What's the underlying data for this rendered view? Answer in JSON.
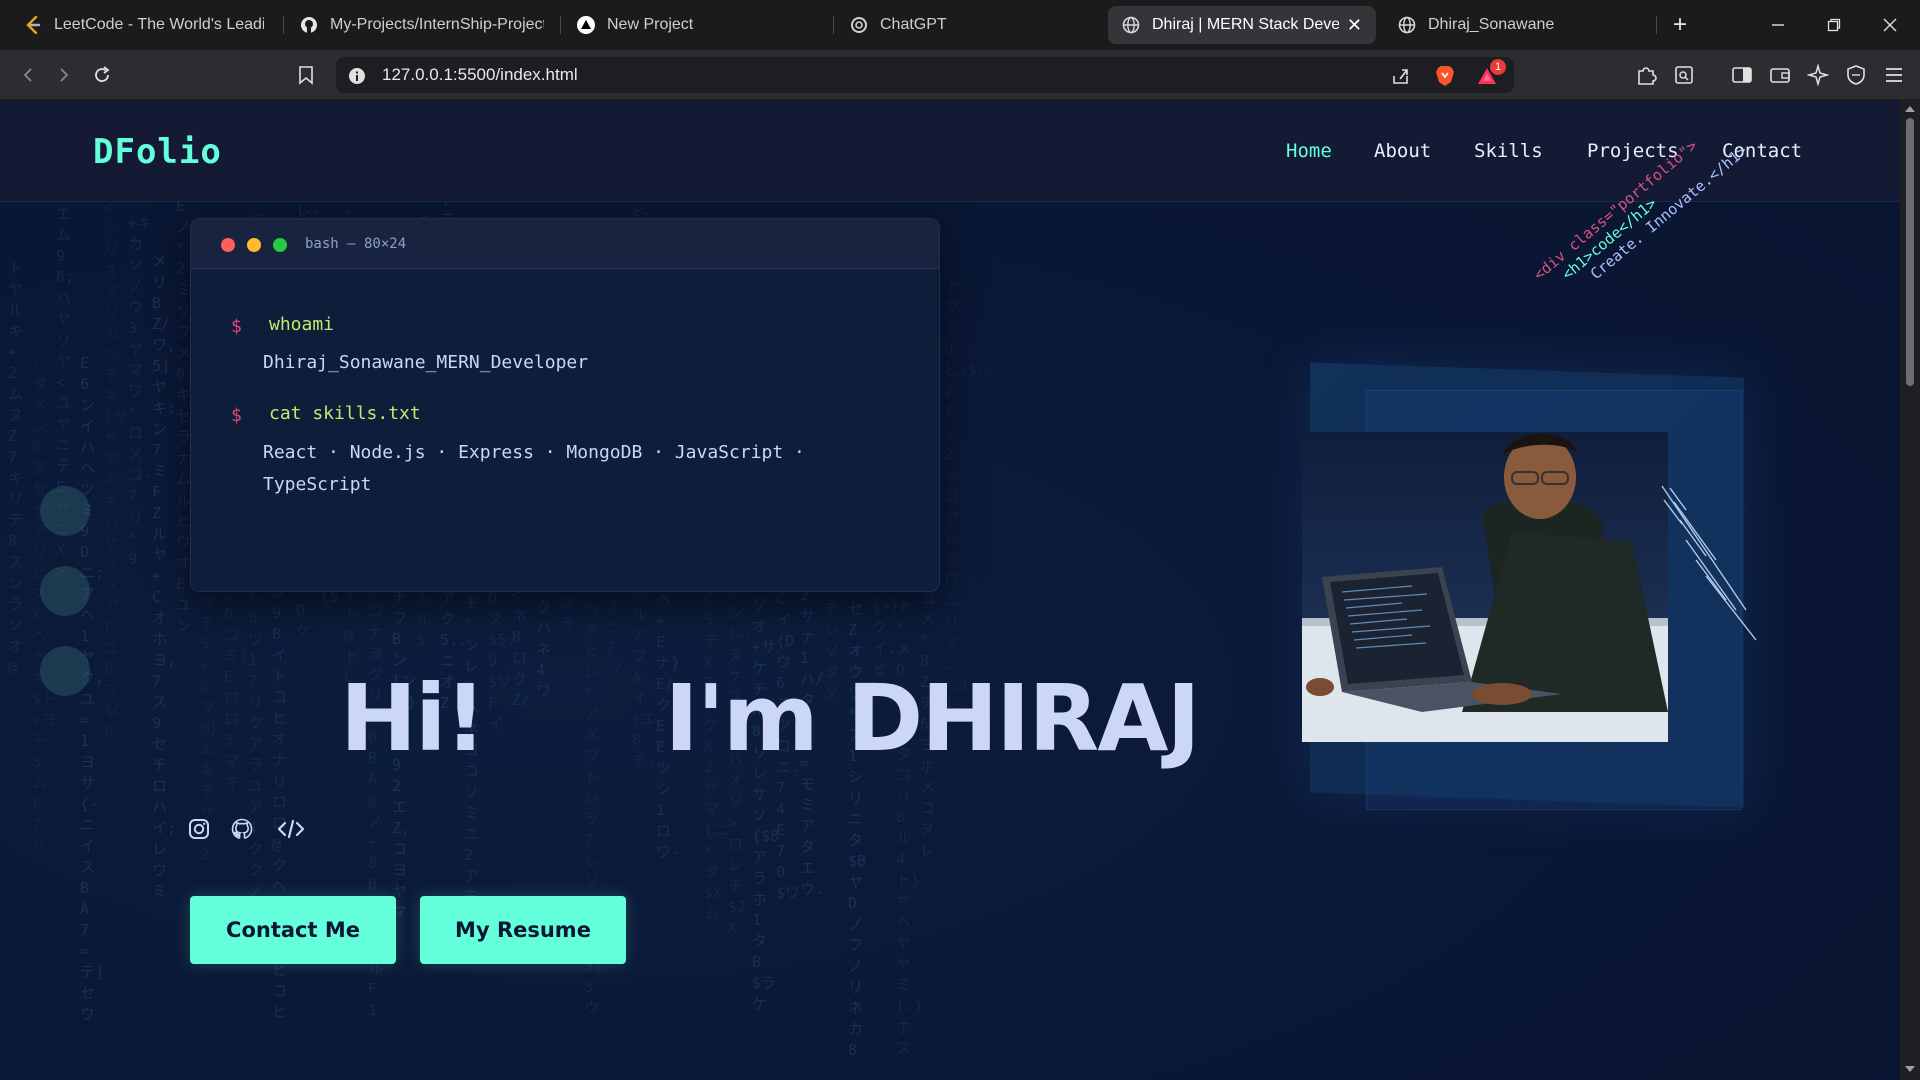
{
  "browser": {
    "tabs": [
      {
        "title": "LeetCode - The World's Leading",
        "icon": "leetcode-icon",
        "active": false
      },
      {
        "title": "My-Projects/InternShip-Project-l",
        "icon": "github-icon",
        "active": false
      },
      {
        "title": "New Project",
        "icon": "vercel-icon",
        "active": false
      },
      {
        "title": "ChatGPT",
        "icon": "chatgpt-icon",
        "active": false
      },
      {
        "title": "Dhiraj | MERN Stack Develop",
        "icon": "globe-icon",
        "active": true
      },
      {
        "title": "Dhiraj_Sonawane",
        "icon": "globe-icon",
        "active": false
      }
    ],
    "url": "127.0.0.1:5500/index.html",
    "notification_count": "1"
  },
  "site": {
    "logo": "DFolio",
    "nav": [
      {
        "label": "Home",
        "active": true
      },
      {
        "label": "About",
        "active": false
      },
      {
        "label": "Skills",
        "active": false
      },
      {
        "label": "Projects",
        "active": false
      },
      {
        "label": "Contact",
        "active": false
      }
    ],
    "terminal": {
      "title": "bash — 80×24",
      "prompt": "$",
      "cmd1": "whoami",
      "out1": "Dhiraj_Sonawane_MERN_Developer",
      "cmd2": "cat skills.txt",
      "out2_line1": "React · Node.js · Express · MongoDB · JavaScript ·",
      "out2_line2": "TypeScript"
    },
    "hero": {
      "greeting": "Hi!",
      "name": "I'm DHIRAJ"
    },
    "socials": [
      {
        "icon": "instagram-icon"
      },
      {
        "icon": "github-icon"
      },
      {
        "icon": "code-icon"
      }
    ],
    "buttons": {
      "contact": "Contact Me",
      "resume": "My Resume"
    },
    "code_banner": {
      "line1": "<div class=\"portfolio\">",
      "line2": "<h1>code</h1>",
      "line3": "Create. Innovate.</h1>"
    }
  },
  "colors": {
    "accent": "#64ffda",
    "page_bg": "#0a1734",
    "nav_bg": "#141a33",
    "text": "#ccd6f6"
  }
}
